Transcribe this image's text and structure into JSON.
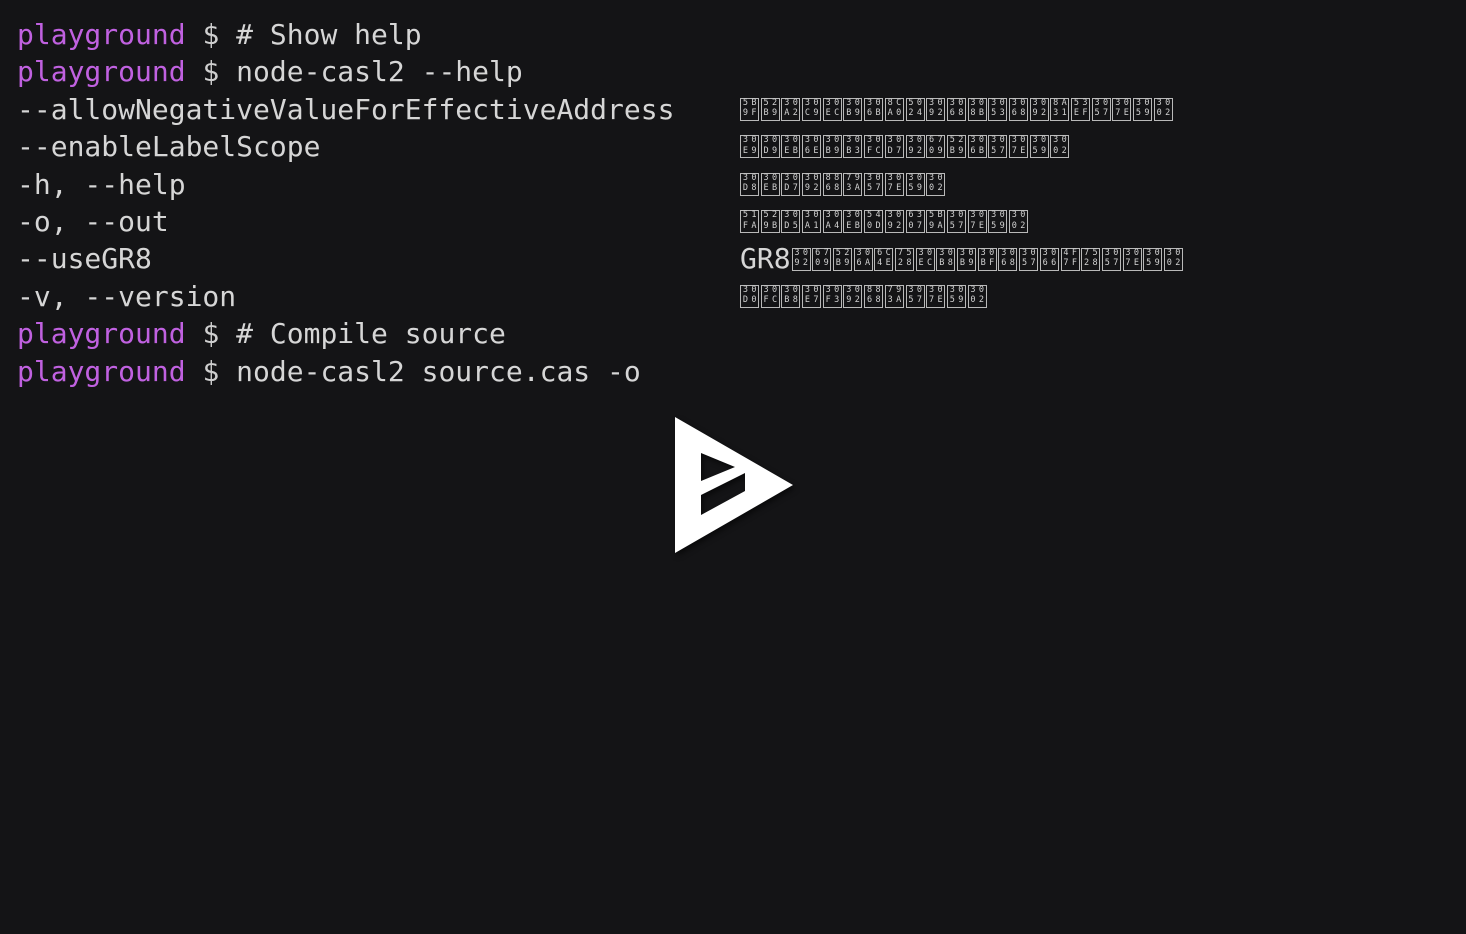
{
  "terminal": {
    "background_color": "#141416",
    "foreground_color": "#d6d6d6",
    "prompt_color": "#c061e0",
    "prompt_host": "playground",
    "prompt_symbol": "$",
    "lines": [
      {
        "type": "command",
        "host": "playground",
        "symbol": "$",
        "command": "# Show help"
      },
      {
        "type": "command",
        "host": "playground",
        "symbol": "$",
        "command": "node-casl2 --help"
      },
      {
        "type": "option",
        "option": "--allowNegativeValueForEffectiveAddress",
        "description_ascii": "",
        "description_text": "実効アドレスに負値をとることを許可します。",
        "description_codepoints": [
          "5B9F",
          "52B9",
          "30A2",
          "30C9",
          "30EC",
          "30B9",
          "306B",
          "8CA0",
          "5024",
          "3092",
          "3068",
          "308B",
          "3053",
          "3068",
          "3092",
          "8A31",
          "53EF",
          "3057",
          "307E",
          "3059",
          "3002"
        ]
      },
      {
        "type": "option",
        "option": "--enableLabelScope",
        "description_ascii": "",
        "description_text": "ラベルのスコープを有効にします。",
        "description_codepoints": [
          "30E9",
          "30D9",
          "30EB",
          "306E",
          "30B9",
          "30B3",
          "30FC",
          "30D7",
          "3092",
          "6709",
          "52B9",
          "306B",
          "3057",
          "307E",
          "3059",
          "3002"
        ]
      },
      {
        "type": "option",
        "option": "-h, --help",
        "description_ascii": "",
        "description_text": "ヘルプを表示します。",
        "description_codepoints": [
          "30D8",
          "30EB",
          "30D7",
          "3092",
          "8868",
          "793A",
          "3057",
          "307E",
          "3059",
          "3002"
        ]
      },
      {
        "type": "option",
        "option": "-o, --out",
        "description_ascii": "",
        "description_text": "出力ファイル名を指定します。",
        "description_codepoints": [
          "51FA",
          "529B",
          "30D5",
          "30A1",
          "30A4",
          "30EB",
          "540D",
          "3092",
          "6307",
          "5B9A",
          "3057",
          "307E",
          "3059",
          "3002"
        ]
      },
      {
        "type": "option",
        "option": "--useGR8",
        "description_ascii": "GR8",
        "description_text": "GR8を有効な汎用レジスタとして使用します。",
        "description_codepoints": [
          "3092",
          "6709",
          "52B9",
          "306A",
          "6C4E",
          "7528",
          "30EC",
          "30B8",
          "30B9",
          "30BF",
          "3068",
          "3057",
          "3066",
          "4F7F",
          "7528",
          "3057",
          "307E",
          "3059",
          "3002"
        ]
      },
      {
        "type": "option",
        "option": "-v, --version",
        "description_ascii": "",
        "description_text": "バージョンを表示します。",
        "description_codepoints": [
          "30D0",
          "30FC",
          "30B8",
          "30E7",
          "30F3",
          "3092",
          "8868",
          "793A",
          "3057",
          "307E",
          "3059",
          "3002"
        ]
      },
      {
        "type": "command",
        "host": "playground",
        "symbol": "$",
        "command": "# Compile source"
      },
      {
        "type": "command",
        "host": "playground",
        "symbol": "$",
        "command": "node-casl2 source.cas -o"
      }
    ]
  },
  "player": {
    "play_button_label": "Play",
    "play_button_color": "#ffffff"
  }
}
